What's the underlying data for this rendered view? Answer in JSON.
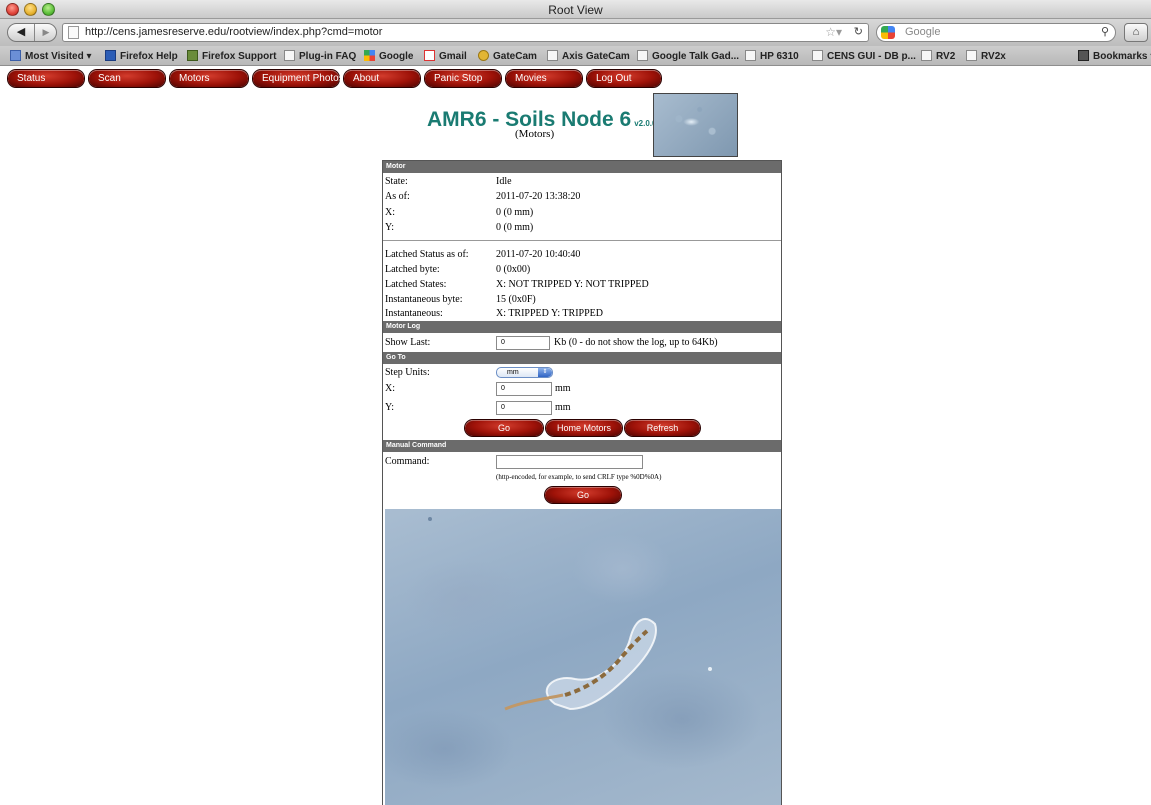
{
  "window": {
    "title": "Root View"
  },
  "browser": {
    "url": "http://cens.jamesreserve.edu/rootview/index.php?cmd=motor",
    "search_placeholder": "Google",
    "bookmarks": [
      {
        "label": "Most Visited ▾",
        "icon": "most-visited-icon"
      },
      {
        "label": "Firefox Help",
        "icon": "s-icon"
      },
      {
        "label": "Firefox Support",
        "icon": "support-icon"
      },
      {
        "label": "Plug-in FAQ",
        "icon": "page-icon"
      },
      {
        "label": "Google",
        "icon": "google-icon"
      },
      {
        "label": "Gmail",
        "icon": "gmail-icon"
      },
      {
        "label": "GateCam",
        "icon": "camera-icon"
      },
      {
        "label": "Axis GateCam",
        "icon": "page-icon"
      },
      {
        "label": "Google Talk Gad...",
        "icon": "page-icon"
      },
      {
        "label": "HP 6310",
        "icon": "page-icon"
      },
      {
        "label": "CENS GUI - DB p...",
        "icon": "page-icon"
      },
      {
        "label": "RV2",
        "icon": "page-icon"
      },
      {
        "label": "RV2x",
        "icon": "page-icon"
      },
      {
        "label": "Bookmarks ▾",
        "icon": "bookmarks-icon"
      }
    ]
  },
  "menu": [
    "Status",
    "Scan",
    "Motors",
    "Equipment Photos",
    "About",
    "Panic Stop",
    "Movies",
    "Log Out"
  ],
  "header": {
    "title": "AMR6 - Soils Node 6",
    "version": "v2.0.0.18",
    "subtitle": "(Motors)"
  },
  "motor": {
    "header": "Motor",
    "rows": [
      {
        "label": "State:",
        "value": "Idle"
      },
      {
        "label": "As of:",
        "value": "2011-07-20 13:38:20"
      },
      {
        "label": "X:",
        "value": "0 (0 mm)"
      },
      {
        "label": "Y:",
        "value": "0 (0 mm)"
      }
    ],
    "latched_rows": [
      {
        "label": "Latched Status as of:",
        "value": "2011-07-20 10:40:40"
      },
      {
        "label": "Latched byte:",
        "value": "0 (0x00)"
      },
      {
        "label": "Latched States:",
        "value": "X: NOT TRIPPED   Y: NOT TRIPPED"
      },
      {
        "label": "Instantaneous byte:",
        "value": "15 (0x0F)"
      },
      {
        "label": "Instantaneous:",
        "value": "X: TRIPPED   Y: TRIPPED"
      }
    ]
  },
  "motor_log": {
    "header": "Motor Log",
    "label": "Show Last:",
    "value": "0",
    "hint": "Kb (0 - do not show the log, up to 64Kb)"
  },
  "goto": {
    "header": "Go To",
    "step_units_label": "Step Units:",
    "step_units_value": "mm",
    "x_label": "X:",
    "x_value": "0",
    "x_unit": "mm",
    "y_label": "Y:",
    "y_value": "0",
    "y_unit": "mm",
    "go_label": "Go",
    "home_label": "Home Motors",
    "refresh_label": "Refresh"
  },
  "manual": {
    "header": "Manual Command",
    "label": "Command:",
    "value": "",
    "hint": "(http-encoded, for example, to send CRLF type %0D%0A)",
    "go_label": "Go"
  }
}
